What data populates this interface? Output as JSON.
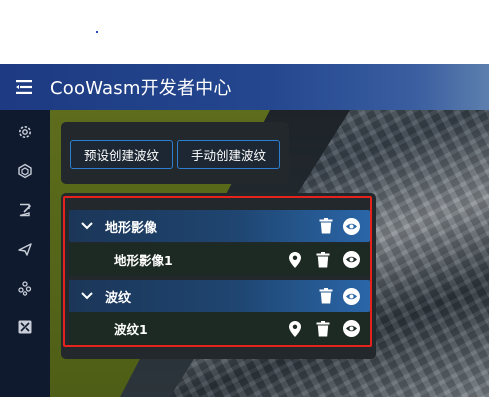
{
  "header": {
    "title": "CooWasm开发者中心"
  },
  "sidebar": {
    "items": [
      {
        "icon": "gear-icon"
      },
      {
        "icon": "cube-icon"
      },
      {
        "icon": "edit-icon"
      },
      {
        "icon": "send-icon"
      },
      {
        "icon": "cluster-icon"
      },
      {
        "icon": "tools-icon"
      }
    ]
  },
  "actions": {
    "preset_create_ripple": "预设创建波纹",
    "manual_create_ripple": "手动创建波纹"
  },
  "layers": {
    "groups": [
      {
        "name": "地形影像",
        "children": [
          {
            "name": "地形影像1"
          }
        ]
      },
      {
        "name": "波纹",
        "children": [
          {
            "name": "波纹1"
          }
        ]
      }
    ]
  },
  "colors": {
    "header_accent": "#1d3a82",
    "button_border": "#2c7fd0",
    "highlight_frame": "#e5231c",
    "sidebar_bg": "#0f1a2e"
  }
}
